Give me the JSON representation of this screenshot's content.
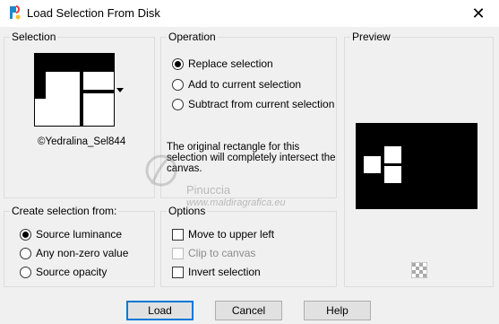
{
  "window": {
    "title": "Load Selection From Disk",
    "close_glyph": "✕"
  },
  "selection": {
    "label": "Selection",
    "filename": "©Yedralina_Sel844",
    "dropdown_icon": "chevron-down-icon"
  },
  "operation": {
    "label": "Operation",
    "options": [
      "Replace selection",
      "Add to current selection",
      "Subtract from current selection"
    ],
    "selected_index": 0,
    "description": "The original rectangle for this selection will completely intersect the canvas."
  },
  "preview": {
    "label": "Preview"
  },
  "create_from": {
    "label": "Create selection from:",
    "options": [
      "Source luminance",
      "Any non-zero value",
      "Source opacity"
    ],
    "selected_index": 0
  },
  "options": {
    "label": "Options",
    "items": [
      {
        "label": "Move to upper left",
        "checked": false,
        "enabled": true
      },
      {
        "label": "Clip to canvas",
        "checked": false,
        "enabled": false
      },
      {
        "label": "Invert selection",
        "checked": false,
        "enabled": true
      }
    ]
  },
  "watermark": {
    "brand": "Pinuccia",
    "site": "www.maldiragrafica.eu"
  },
  "buttons": {
    "load": "Load",
    "cancel": "Cancel",
    "help": "Help"
  },
  "colors": {
    "accent": "#0078d7",
    "background": "#f0f0f0"
  }
}
